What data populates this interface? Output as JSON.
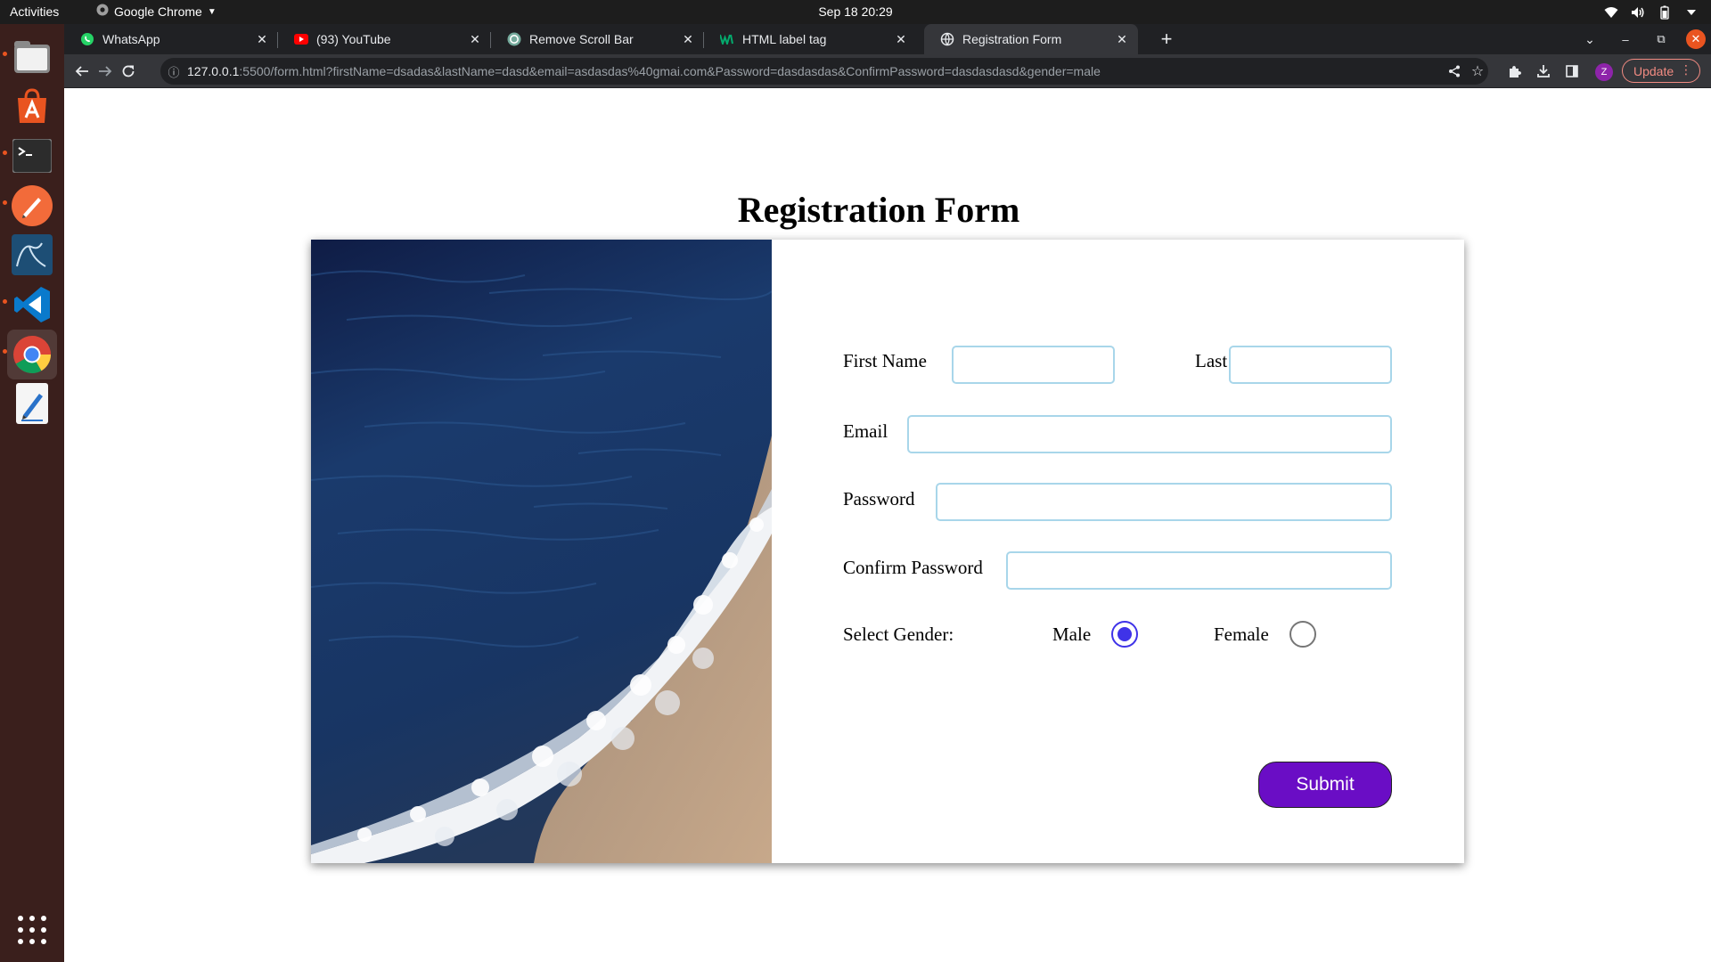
{
  "system": {
    "activities": "Activities",
    "app_menu": "Google Chrome",
    "clock": "Sep 18  20:29"
  },
  "dock": {
    "apps": [
      "files-icon",
      "software-store-icon",
      "terminal-icon",
      "drawing-app-icon",
      "database-workbench-icon",
      "vscode-icon",
      "chrome-icon",
      "text-editor-icon"
    ]
  },
  "tabs": [
    {
      "title": "WhatsApp",
      "icon": "whatsapp-icon"
    },
    {
      "title": "(93) YouTube",
      "icon": "youtube-icon"
    },
    {
      "title": "Remove Scroll Bar",
      "icon": "openai-icon"
    },
    {
      "title": "HTML label tag",
      "icon": "w3-icon"
    },
    {
      "title": "Registration Form",
      "icon": "globe-icon",
      "active": true
    }
  ],
  "toolbar": {
    "url_host": "127.0.0.1",
    "url_rest": ":5500/form.html?firstName=dsadas&lastName=dasd&email=asdasdas%40gmai.com&Password=dasdasdas&ConfirmPassword=dasdasdasd&gender=male",
    "profile_initial": "Z",
    "update_label": "Update"
  },
  "form": {
    "title": "Registration Form",
    "first_name_label": "First Name",
    "last_name_label": "Last Name",
    "email_label": "Email",
    "password_label": "Password",
    "confirm_password_label": "Confirm Password",
    "gender_label": "Select Gender:",
    "male_label": "Male",
    "female_label": "Female",
    "selected_gender": "male",
    "submit_label": "Submit",
    "first_name_value": "",
    "last_name_value": "",
    "email_value": "",
    "password_value": "",
    "confirm_password_value": ""
  },
  "colors": {
    "submit_bg": "#6a0dc5",
    "input_border": "#a8d6ea",
    "radio_checked": "#3f33e8",
    "update_accent": "#f28b82"
  }
}
